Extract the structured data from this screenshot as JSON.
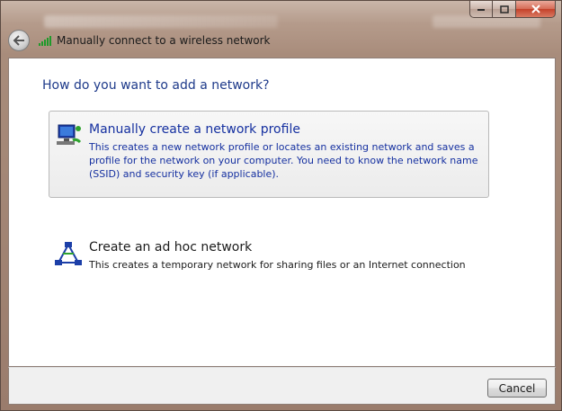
{
  "window": {
    "title": "Manually connect to a wireless network",
    "caption_buttons": [
      "minimize",
      "maximize",
      "close"
    ]
  },
  "nav": {
    "back_icon": "back-arrow-icon",
    "title_icon": "wifi-signal-icon"
  },
  "main": {
    "heading": "How do you want to add a network?",
    "options": [
      {
        "title": "Manually create a network profile",
        "description": "This creates a new network profile or locates an existing network and saves a profile for the network on your computer. You need to know the network name (SSID) and security key (if applicable).",
        "icon": "network-profile-icon",
        "selected": true
      },
      {
        "title": "Create an ad hoc network",
        "description": "This creates a temporary network for sharing files or an Internet connection",
        "icon": "ad-hoc-network-icon",
        "selected": false
      }
    ]
  },
  "footer": {
    "cancel_label": "Cancel"
  },
  "colors": {
    "link_blue": "#1530a0",
    "heading_blue": "#1e3a8a",
    "close_red": "#c4412a"
  }
}
